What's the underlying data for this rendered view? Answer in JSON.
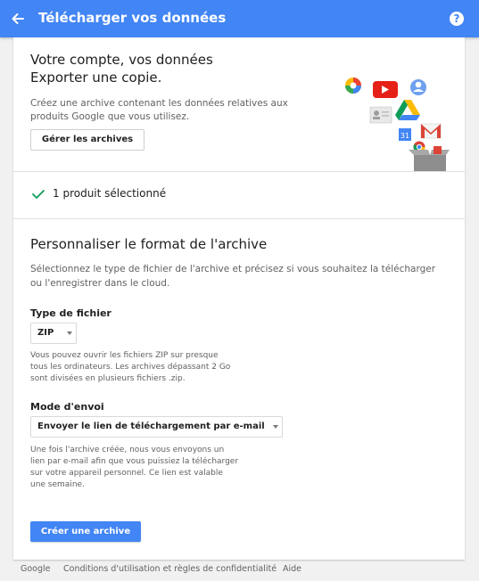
{
  "header": {
    "title": "Télécharger vos données"
  },
  "intro": {
    "headline_line1": "Votre compte, vos données",
    "headline_line2": "Exporter une copie.",
    "description": "Créez une archive contenant les données relatives aux produits Google que vous utilisez.",
    "manage_button": "Gérer les archives"
  },
  "selection": {
    "label": "1 produit sélectionné"
  },
  "format": {
    "title": "Personnaliser le format de l'archive",
    "description": "Sélectionnez le type de fichier de l'archive et précisez si vous souhaitez la télécharger ou l'enregistrer dans le cloud.",
    "file_type_label": "Type de fichier",
    "file_type_value": "ZIP",
    "file_type_help": "Vous pouvez ouvrir les fichiers ZIP sur presque tous les ordinateurs. Les archives dépassant 2 Go sont divisées en plusieurs fichiers .zip.",
    "delivery_label": "Mode d'envoi",
    "delivery_value": "Envoyer le lien de téléchargement par e-mail",
    "delivery_help": "Une fois l'archive créée, nous vous envoyons un lien par e-mail afin que vous puissiez la télécharger sur votre appareil personnel. Ce lien est valable une semaine.",
    "create_button": "Créer une archive"
  },
  "illustration": {
    "calendar_text": "31"
  },
  "footer": {
    "links": [
      "Google",
      "Conditions d'utilisation et règles de confidentialité",
      "Aide"
    ]
  },
  "colors": {
    "accent": "#4285f4",
    "check": "#0f9d58"
  }
}
